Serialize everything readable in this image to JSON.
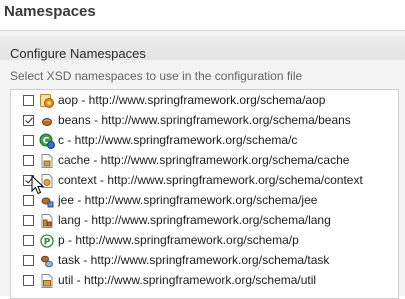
{
  "page": {
    "title": "Namespaces"
  },
  "section": {
    "title": "Configure Namespaces",
    "description": "Select XSD namespaces to use in the configuration file"
  },
  "namespaces": [
    {
      "label": "aop - http://www.springframework.org/schema/aop",
      "checked": false,
      "icon": "aop-icon"
    },
    {
      "label": "beans - http://www.springframework.org/schema/beans",
      "checked": true,
      "icon": "bean-icon"
    },
    {
      "label": "c - http://www.springframework.org/schema/c",
      "checked": false,
      "icon": "c-namespace-icon"
    },
    {
      "label": "cache - http://www.springframework.org/schema/cache",
      "checked": false,
      "icon": "cache-icon"
    },
    {
      "label": "context - http://www.springframework.org/schema/context",
      "checked": true,
      "icon": "context-icon"
    },
    {
      "label": "jee - http://www.springframework.org/schema/jee",
      "checked": false,
      "icon": "jee-icon"
    },
    {
      "label": "lang - http://www.springframework.org/schema/lang",
      "checked": false,
      "icon": "lang-icon"
    },
    {
      "label": "p - http://www.springframework.org/schema/p",
      "checked": false,
      "icon": "p-namespace-icon"
    },
    {
      "label": "task - http://www.springframework.org/schema/task",
      "checked": false,
      "icon": "task-icon"
    },
    {
      "label": "util - http://www.springframework.org/schema/util",
      "checked": false,
      "icon": "util-icon"
    }
  ]
}
